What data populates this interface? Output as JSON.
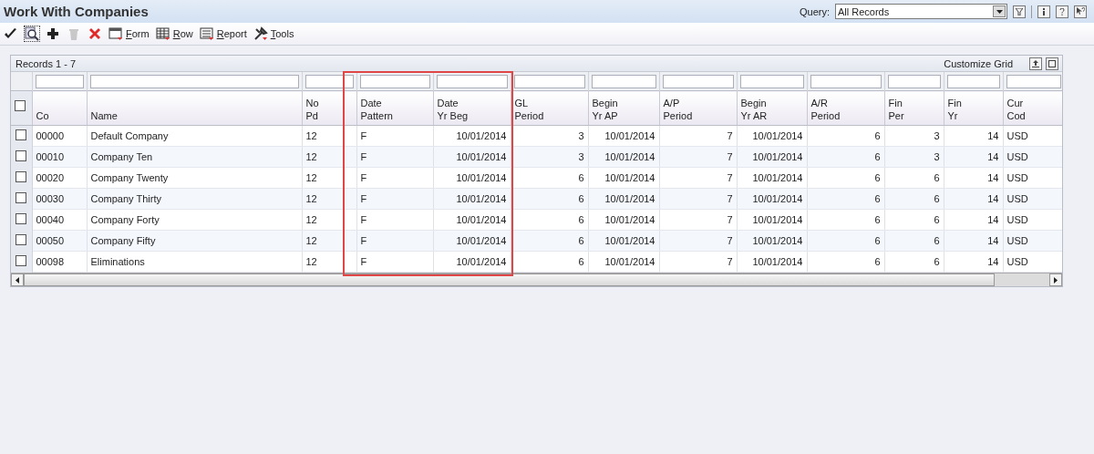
{
  "window": {
    "title": "Work With Companies"
  },
  "query": {
    "label": "Query:",
    "value": "All Records"
  },
  "toolbar": [
    {
      "kind": "select"
    },
    {
      "kind": "find"
    },
    {
      "kind": "add"
    },
    {
      "kind": "delete",
      "disabled": true
    },
    {
      "kind": "close"
    },
    {
      "kind": "form",
      "label": "Form"
    },
    {
      "kind": "row",
      "label": "Row"
    },
    {
      "kind": "report",
      "label": "Report"
    },
    {
      "kind": "tools",
      "label": "Tools"
    }
  ],
  "grid": {
    "records": "Records 1 - 7",
    "customize": "Customize Grid",
    "header_checked": false,
    "columns": [
      {
        "label": [
          "Co"
        ],
        "kind": "text"
      },
      {
        "label": [
          "Name"
        ],
        "kind": "text"
      },
      {
        "label": [
          "No",
          "Pd"
        ],
        "kind": "text"
      },
      {
        "label": [
          "Date",
          "Pattern"
        ],
        "kind": "text",
        "highlighted": true
      },
      {
        "label": [
          "Date",
          "Yr Beg"
        ],
        "kind": "number",
        "highlighted": true
      },
      {
        "label": [
          "GL",
          "Period"
        ],
        "kind": "number"
      },
      {
        "label": [
          "Begin",
          "Yr AP"
        ],
        "kind": "number"
      },
      {
        "label": [
          "A/P",
          "Period"
        ],
        "kind": "number"
      },
      {
        "label": [
          "Begin",
          "Yr AR"
        ],
        "kind": "number"
      },
      {
        "label": [
          "A/R",
          "Period"
        ],
        "kind": "number"
      },
      {
        "label": [
          "Fin",
          "Per"
        ],
        "kind": "number"
      },
      {
        "label": [
          "Fin",
          "Yr"
        ],
        "kind": "number"
      },
      {
        "label": [
          "Cur",
          "Cod"
        ],
        "kind": "text"
      }
    ],
    "rows": [
      {
        "checked": false,
        "cells": [
          "00000",
          "Default Company",
          "12",
          "F",
          "10/01/2014",
          "3",
          "10/01/2014",
          "7",
          "10/01/2014",
          "6",
          "3",
          "14",
          "USD"
        ]
      },
      {
        "checked": false,
        "cells": [
          "00010",
          "Company Ten",
          "12",
          "F",
          "10/01/2014",
          "3",
          "10/01/2014",
          "7",
          "10/01/2014",
          "6",
          "3",
          "14",
          "USD"
        ]
      },
      {
        "checked": false,
        "cells": [
          "00020",
          "Company Twenty",
          "12",
          "F",
          "10/01/2014",
          "6",
          "10/01/2014",
          "7",
          "10/01/2014",
          "6",
          "6",
          "14",
          "USD"
        ]
      },
      {
        "checked": false,
        "cells": [
          "00030",
          "Company Thirty",
          "12",
          "F",
          "10/01/2014",
          "6",
          "10/01/2014",
          "7",
          "10/01/2014",
          "6",
          "6",
          "14",
          "USD"
        ]
      },
      {
        "checked": false,
        "cells": [
          "00040",
          "Company Forty",
          "12",
          "F",
          "10/01/2014",
          "6",
          "10/01/2014",
          "7",
          "10/01/2014",
          "6",
          "6",
          "14",
          "USD"
        ]
      },
      {
        "checked": false,
        "cells": [
          "00050",
          "Company Fifty",
          "12",
          "F",
          "10/01/2014",
          "6",
          "10/01/2014",
          "7",
          "10/01/2014",
          "6",
          "6",
          "14",
          "USD"
        ]
      },
      {
        "checked": false,
        "cells": [
          "00098",
          "Eliminations",
          "12",
          "F",
          "10/01/2014",
          "6",
          "10/01/2014",
          "7",
          "10/01/2014",
          "6",
          "6",
          "14",
          "USD"
        ]
      }
    ]
  }
}
